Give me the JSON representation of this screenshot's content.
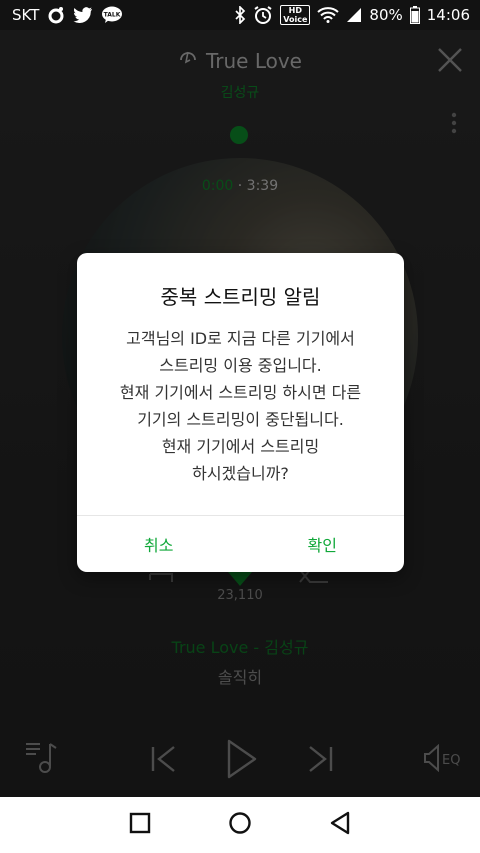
{
  "status_bar": {
    "carrier": "SKT",
    "hd_label": "HD",
    "voice_label": "Voice",
    "talk_label": "TALK",
    "battery": "80%",
    "time": "14:06"
  },
  "player": {
    "song_title": "True Love",
    "artist": "김성규",
    "current_time": "0:00",
    "separator": "·",
    "total_time": "3:39",
    "like_count": "23,110",
    "now_playing": "True Love - 김성규",
    "lyric_line": "솔직히",
    "eq_label": "EQ"
  },
  "dialog": {
    "title": "중복 스트리밍 알림",
    "lines": [
      "고객님의 ID로 지금 다른 기기에서",
      "스트리밍 이용 중입니다.",
      "현재 기기에서 스트리밍 하시면 다른",
      "기기의 스트리밍이 중단됩니다.",
      "현재 기기에서 스트리밍",
      "하시겠습니까?"
    ],
    "cancel_label": "취소",
    "confirm_label": "확인"
  },
  "colors": {
    "accent_green": "#11a83a",
    "dark_green": "#0f8a2c"
  },
  "icons": [
    "wifi-icon",
    "bluetooth-icon",
    "alarm-icon",
    "battery-icon",
    "close-icon",
    "more-icon",
    "playlist-icon",
    "prev-icon",
    "play-icon",
    "next-icon",
    "eq-icon",
    "back-nav-icon",
    "home-nav-icon",
    "recents-nav-icon"
  ]
}
